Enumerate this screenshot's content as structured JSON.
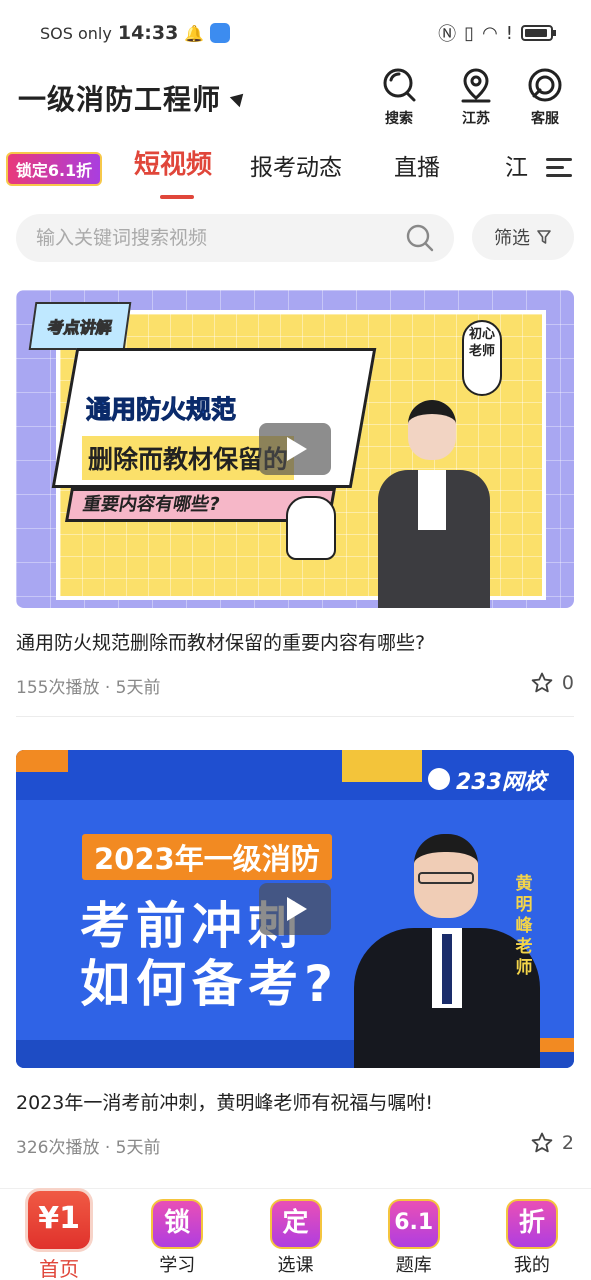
{
  "status_bar": {
    "carrier": "SOS only",
    "time": "14:33"
  },
  "header": {
    "title": "一级消防工程师",
    "actions": [
      {
        "label": "搜索",
        "icon": "search-icon"
      },
      {
        "label": "江苏",
        "icon": "location-pin-icon"
      },
      {
        "label": "客服",
        "icon": "headset-icon"
      }
    ]
  },
  "tabs": {
    "promo": "锁定6.1折",
    "items": [
      "短视频",
      "报考动态",
      "直播",
      "江"
    ],
    "active_index": 0
  },
  "search": {
    "placeholder": "输入关键词搜索视频",
    "filter_label": "筛选"
  },
  "videos": [
    {
      "thumb": {
        "tag": "考点讲解",
        "line1": "通用防火规范",
        "line2": "删除而教材保留的",
        "line3": "重要内容有哪些?",
        "stamp": "初心老师"
      },
      "title": "通用防火规范删除而教材保留的重要内容有哪些?",
      "meta": "155次播放 · 5天前",
      "favorites": "0"
    },
    {
      "thumb": {
        "brand": "233网校",
        "headline": "2023年一级消防",
        "big1": "考前冲刺",
        "big2": "如何备考?",
        "teacher": "黄明峰老师"
      },
      "title": "2023年一消考前冲刺，黄明峰老师有祝福与嘱咐!",
      "meta": "326次播放 · 5天前",
      "favorites": "2"
    }
  ],
  "bottom_nav": [
    {
      "badge": "¥1",
      "label": "首页",
      "active": true
    },
    {
      "badge": "锁",
      "label": "学习"
    },
    {
      "badge": "定",
      "label": "选课"
    },
    {
      "badge": "6.1",
      "label": "题库"
    },
    {
      "badge": "折",
      "label": "我的"
    }
  ],
  "colors": {
    "accent": "#e0463a",
    "promo_gradient": [
      "#e94fb6",
      "#b03ee0"
    ],
    "search_bg": "#f3f3f3"
  }
}
